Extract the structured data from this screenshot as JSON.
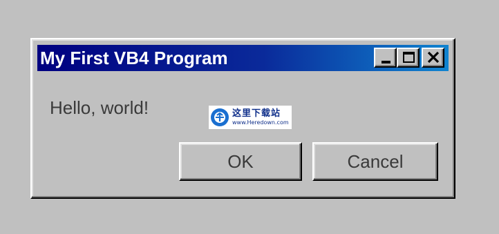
{
  "window": {
    "title": "My First VB4 Program",
    "controls": {
      "minimize_icon": "minimize-icon",
      "maximize_icon": "maximize-icon",
      "close_icon": "close-icon"
    }
  },
  "content": {
    "message": "Hello, world!"
  },
  "buttons": {
    "ok_label": "OK",
    "cancel_label": "Cancel"
  },
  "watermark": {
    "brand_cn": "这里下载站",
    "url": "www.Heredown.com"
  },
  "colors": {
    "desktop": "#c0c0c0",
    "titlebar_start": "#000080",
    "titlebar_end": "#1084d0",
    "title_text": "#ffffff",
    "body_text": "#3a3a3a"
  }
}
